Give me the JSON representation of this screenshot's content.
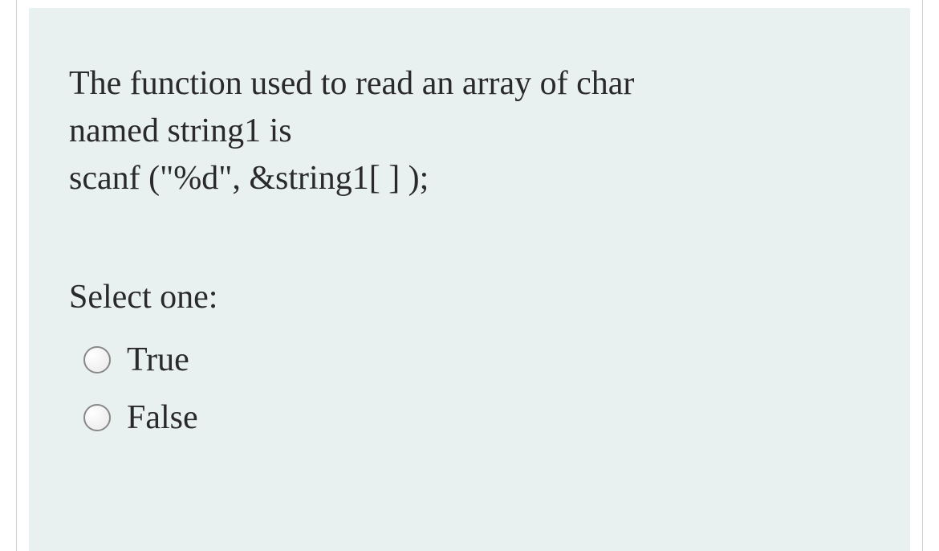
{
  "question": {
    "line1": "The function used to read an array of char",
    "line2": "named string1 is",
    "line3": "scanf (\"%d\", &string1[ ] );"
  },
  "prompt": "Select one:",
  "options": [
    {
      "label": "True"
    },
    {
      "label": "False"
    }
  ]
}
